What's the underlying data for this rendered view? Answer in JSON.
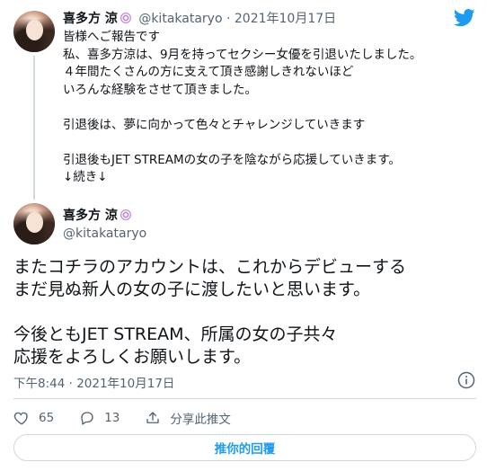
{
  "colors": {
    "accent": "#1d9bf0",
    "muted": "#536471",
    "line": "#cfd9de"
  },
  "tweet1": {
    "name": "喜多方 涼",
    "handle": "@kitakataryo",
    "separator": "·",
    "date": "2021年10月17日",
    "lines": [
      "皆様へご報告です",
      "私、喜多方涼は、9月を持ってセクシー女優を引退いたしました。",
      "４年間たくさんの方に支えて頂き感謝しきれないほど",
      "いろんな経験をさせて頂きました。",
      "",
      "引退後は、夢に向かって色々とチャレンジしていきます",
      "",
      "引退後もJET STREAMの女の子を陰ながら応援していきます。",
      "↓続き↓"
    ]
  },
  "tweet2": {
    "name": "喜多方 涼",
    "handle": "@kitakataryo",
    "lines": [
      "またコチラのアカウントは、これからデビューする",
      "まだ見ぬ新人の女の子に渡したいと思います。",
      "",
      "今後ともJET STREAM、所属の女の子共々",
      "応援をよろしくお願いします。"
    ],
    "timestamp": "下午8:44 · 2021年10月17日",
    "likes": "65",
    "replies": "13",
    "share_label": "分享此推文",
    "reply_button": "推你的回覆"
  },
  "icons": [
    "twitter-bird-icon",
    "verified-badge-icon",
    "info-icon",
    "heart-icon",
    "reply-icon",
    "share-icon"
  ]
}
